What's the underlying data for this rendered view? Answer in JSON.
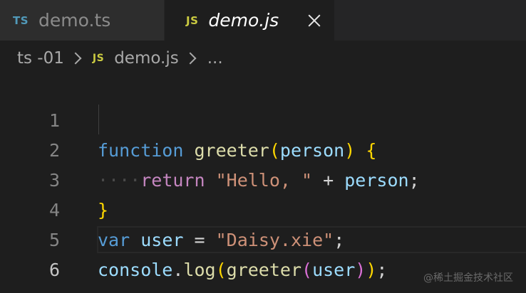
{
  "tabs": [
    {
      "badge": "TS",
      "label": "demo.ts",
      "active": false
    },
    {
      "badge": "JS",
      "label": "demo.js",
      "active": true
    }
  ],
  "breadcrumb": {
    "folder": "ts -01",
    "file_badge": "JS",
    "file": "demo.js",
    "more": "..."
  },
  "editor": {
    "current_line": 6,
    "lines": [
      {
        "num": "1",
        "tokens": [
          "function",
          " ",
          "greeter",
          "(",
          "person",
          ")",
          " ",
          "{"
        ]
      },
      {
        "num": "2",
        "tokens": [
          "····",
          "return",
          " ",
          "\"Hello, \"",
          " ",
          "+",
          " ",
          "person",
          ";"
        ]
      },
      {
        "num": "3",
        "tokens": [
          "}"
        ]
      },
      {
        "num": "4",
        "tokens": [
          "var",
          " ",
          "user",
          " ",
          "=",
          " ",
          "\"Daisy.xie\"",
          ";"
        ]
      },
      {
        "num": "5",
        "tokens": [
          "console",
          ".",
          "log",
          "(",
          "greeter",
          "(",
          "user",
          ")",
          ")",
          ";"
        ]
      },
      {
        "num": "6",
        "tokens": []
      }
    ]
  },
  "watermark": "@稀土掘金技术社区",
  "colors": {
    "editor_bg": "#1e1e1e",
    "tab_bar_bg": "#252526",
    "ts_badge": "#519aba",
    "js_badge": "#cbcb41",
    "keyword": "#569cd6",
    "control": "#c586c0",
    "function": "#dcdcaa",
    "variable": "#9cdcfe",
    "string": "#ce9178"
  },
  "icons": {
    "close": "close-icon",
    "breadcrumb_separator": "chevron-right-icon"
  }
}
